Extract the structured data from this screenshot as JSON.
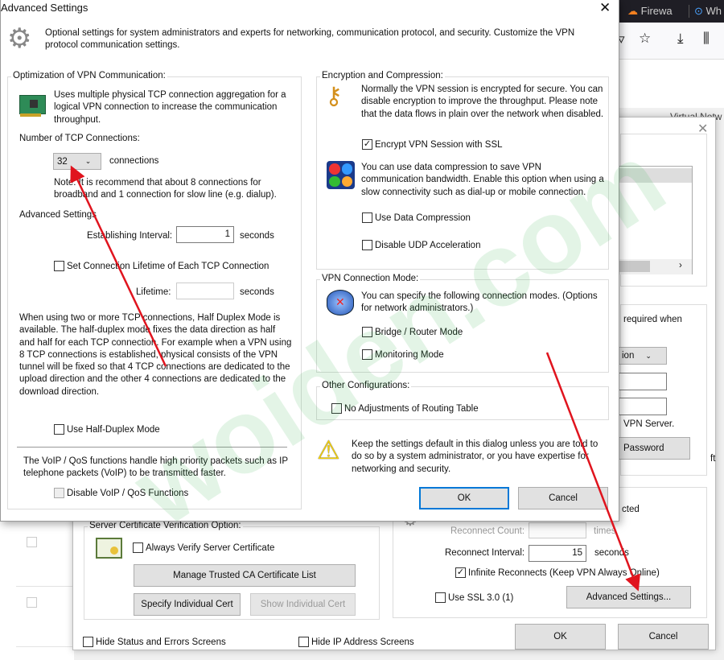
{
  "browser": {
    "tabs": [
      "Firewa",
      "Wh"
    ],
    "toolbar_icons": [
      "pocket-icon",
      "star-icon",
      "download-icon",
      "library-icon"
    ]
  },
  "background_dialog": {
    "header_fragment": "Virtual Netw",
    "auth_fragment": "required when",
    "auth_select_fragment": "ion",
    "vpn_server_fragment": "VPN Server.",
    "password_button_fragment": "Password",
    "right_edge_fragment": "ft",
    "reconnect_fragment": "cted",
    "cert_group_title": "Server Certificate Verification Option:",
    "always_verify": "Always Verify Server Certificate",
    "manage_ca": "Manage Trusted CA Certificate List",
    "specify_cert": "Specify Individual Cert",
    "show_cert": "Show Individual Cert",
    "reconnect_count_label": "Reconnect Count:",
    "reconnect_count_unit": "times",
    "reconnect_interval_label": "Reconnect Interval:",
    "reconnect_interval_value": "15",
    "reconnect_interval_unit": "seconds",
    "infinite_reconnects": "Infinite Reconnects (Keep VPN Always Online)",
    "use_ssl3": "Use SSL 3.0 (1)",
    "advanced_settings_button": "Advanced Settings...",
    "hide_status": "Hide Status and Errors Screens",
    "hide_ip": "Hide IP Address Screens",
    "ok": "OK",
    "cancel": "Cancel"
  },
  "dialog": {
    "title": "Advanced Settings",
    "description": "Optional settings for system administrators and experts for networking, communication protocol, and security. Customize the VPN protocol communication settings.",
    "optimization": {
      "title": "Optimization of VPN Communication:",
      "intro": "Uses multiple physical TCP connection aggregation for a logical VPN connection to increase the communication throughput.",
      "tcp_label": "Number of TCP Connections:",
      "tcp_value": "32",
      "tcp_unit": "connections",
      "note": "Note: It is recommend that about 8 connections for broadband and 1 connection for slow line (e.g. dialup).",
      "advanced_label": "Advanced Settings",
      "interval_label": "Establishing Interval:",
      "interval_value": "1",
      "interval_unit": "seconds",
      "lifetime_check": "Set Connection Lifetime of Each TCP Connection",
      "lifetime_label": "Lifetime:",
      "lifetime_value": "",
      "lifetime_unit": "seconds",
      "half_duplex_text": "When using two or more TCP connections, Half Duplex Mode is available. The half-duplex mode fixes the data direction as half and half for each TCP connection. For example when a VPN using 8 TCP connections is established, physical consists of the VPN tunnel will be fixed so that 4 TCP connections are dedicated to the upload direction and the other 4 connections are dedicated to the download direction.",
      "half_duplex_check": "Use Half-Duplex Mode",
      "voip_text": "The VoIP / QoS functions handle high priority packets such as IP telephone packets (VoIP) to be transmitted faster.",
      "voip_check": "Disable VoIP / QoS Functions"
    },
    "encryption": {
      "title": "Encryption and Compression:",
      "text": "Normally the VPN session is encrypted for secure. You can disable encryption to improve the throughput. Please note that the data flows in plain over the network when disabled.",
      "encrypt_check": "Encrypt VPN Session with SSL",
      "encrypt_checked": true,
      "compression_text": "You can use data compression to save VPN communication bandwidth. Enable this option when using a slow connectivity such as dial-up or mobile connection.",
      "compression_check": "Use Data Compression",
      "udp_check": "Disable UDP Acceleration"
    },
    "mode": {
      "title": "VPN Connection Mode:",
      "text": "You can specify the following connection modes. (Options for network administrators.)",
      "bridge": "Bridge / Router Mode",
      "monitoring": "Monitoring Mode"
    },
    "other": {
      "title": "Other Configurations:",
      "routing": "No Adjustments of Routing Table"
    },
    "warning": "Keep the settings default in this dialog unless you are told to do so by a system administrator, or you have expertise for networking and security.",
    "ok": "OK",
    "cancel": "Cancel"
  },
  "watermark": "woiden.com",
  "colors": {
    "arrow": "#e0141e",
    "accent": "#0078d7",
    "watermark": "#2fb24a"
  }
}
